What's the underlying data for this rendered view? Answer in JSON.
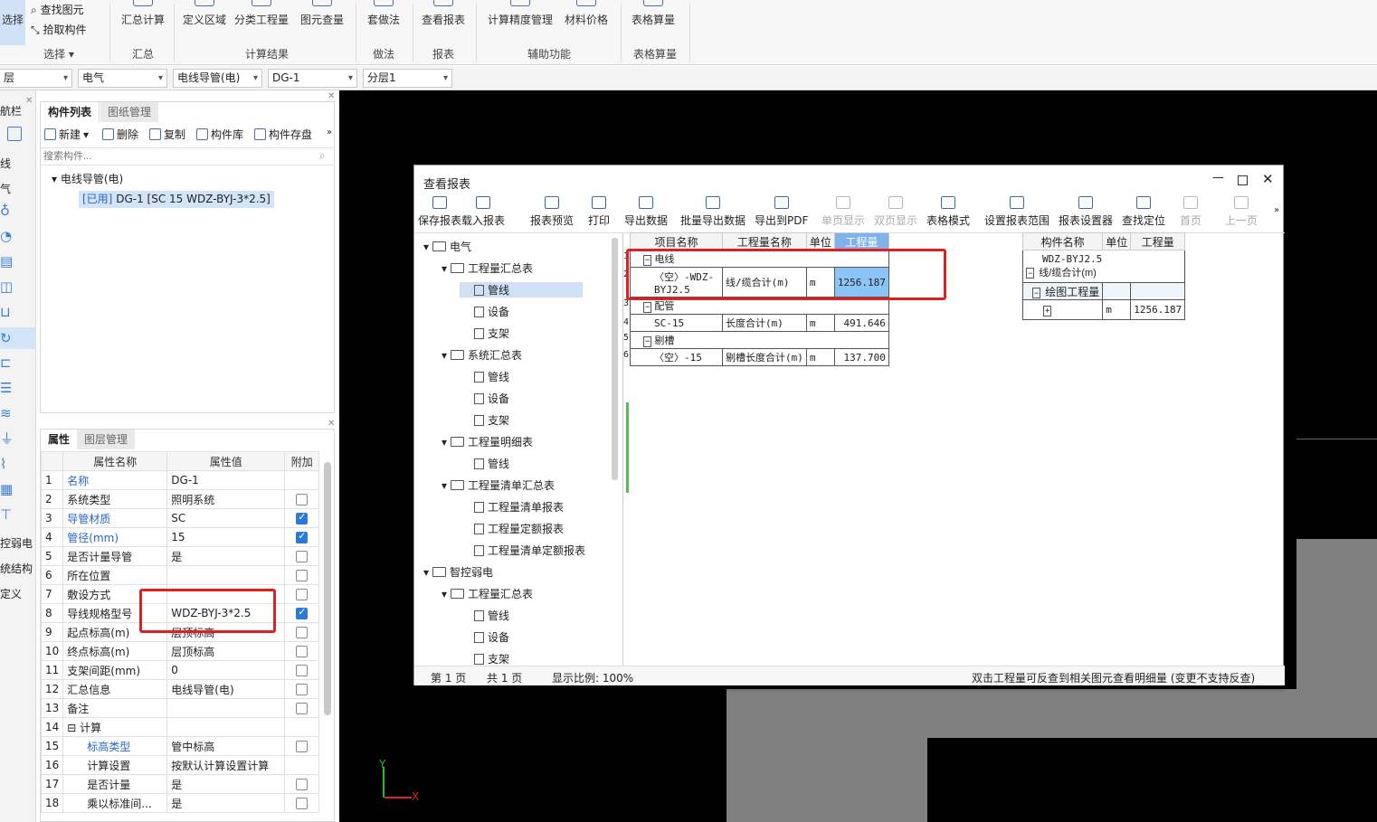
{
  "ribbon": {
    "select_btn": "选择",
    "find_elem": "查找图元",
    "pick_comp": "拾取构件",
    "select_group": "选择",
    "summary_btn": "汇总计算",
    "summary_group": "汇总",
    "calc_buttons": [
      "定义区域",
      "分类工程量",
      "图元查量"
    ],
    "calc_group": "计算结果",
    "method_btn": "套做法",
    "method_group": "做法",
    "report_btn": "查看报表",
    "report_group": "报表",
    "aux_buttons": [
      "计算精度管理",
      "材料价格"
    ],
    "aux_group": "辅助功能",
    "table_btn": "表格算量",
    "table_group": "表格算量"
  },
  "filter": {
    "layer": "层",
    "major": "电气",
    "type": "电线导管(电)",
    "name": "DG-1",
    "sublayer": "分层1"
  },
  "leftedge": {
    "nav": "航栏",
    "items": [
      "线",
      "气",
      "控弱电",
      "统结构",
      "定义"
    ]
  },
  "comp": {
    "tabs": [
      "构件列表",
      "图纸管理"
    ],
    "toolbar": [
      "新建",
      "删除",
      "复制",
      "构件库",
      "构件存盘"
    ],
    "search_placeholder": "搜索构件...",
    "group": "电线导管(电)",
    "item_tag": "[已用]",
    "item": "DG-1 [SC 15 WDZ-BYJ-3*2.5]"
  },
  "props": {
    "tabs": [
      "属性",
      "图层管理"
    ],
    "headers": [
      "属性名称",
      "属性值",
      "附加"
    ],
    "rows": [
      {
        "n": "1",
        "name": "名称",
        "val": "DG-1",
        "blue": true,
        "cb": null
      },
      {
        "n": "2",
        "name": "系统类型",
        "val": "照明系统",
        "blue": false,
        "cb": false
      },
      {
        "n": "3",
        "name": "导管材质",
        "val": "SC",
        "blue": true,
        "cb": true
      },
      {
        "n": "4",
        "name": "管径(mm)",
        "val": "15",
        "blue": true,
        "cb": true
      },
      {
        "n": "5",
        "name": "是否计量导管",
        "val": "是",
        "blue": false,
        "cb": false
      },
      {
        "n": "6",
        "name": "所在位置",
        "val": "",
        "blue": false,
        "cb": false
      },
      {
        "n": "7",
        "name": "敷设方式",
        "val": "",
        "blue": false,
        "cb": false
      },
      {
        "n": "8",
        "name": "导线规格型号",
        "val": "WDZ-BYJ-3*2.5",
        "blue": false,
        "cb": true
      },
      {
        "n": "9",
        "name": "起点标高(m)",
        "val": "层顶标高",
        "blue": false,
        "cb": false
      },
      {
        "n": "10",
        "name": "终点标高(m)",
        "val": "层顶标高",
        "blue": false,
        "cb": false
      },
      {
        "n": "11",
        "name": "支架间距(mm)",
        "val": "0",
        "blue": false,
        "cb": false
      },
      {
        "n": "12",
        "name": "汇总信息",
        "val": "电线导管(电)",
        "blue": false,
        "cb": false
      },
      {
        "n": "13",
        "name": "备注",
        "val": "",
        "blue": false,
        "cb": false
      },
      {
        "n": "14",
        "name": "计算",
        "val": "",
        "blue": false,
        "cb": null
      },
      {
        "n": "15",
        "name": "标高类型",
        "val": "管中标高",
        "blue": true,
        "cb": false
      },
      {
        "n": "16",
        "name": "计算设置",
        "val": "按默认计算设置计算",
        "blue": false,
        "cb": null
      },
      {
        "n": "17",
        "name": "是否计量",
        "val": "是",
        "blue": false,
        "cb": false
      },
      {
        "n": "18",
        "name": "乘以标准间...",
        "val": "是",
        "blue": false,
        "cb": false
      }
    ]
  },
  "dialog": {
    "title": "查看报表",
    "toolbar": [
      "保存报表",
      "载入报表",
      "报表预览",
      "打印",
      "导出数据",
      "批量导出数据",
      "导出到PDF",
      "单页显示",
      "双页显示",
      "表格模式",
      "设置报表范围",
      "报表设置器",
      "查找定位",
      "首页",
      "上一页"
    ],
    "tree": [
      {
        "lvl": 0,
        "t": "电气",
        "k": "f"
      },
      {
        "lvl": 1,
        "t": "工程量汇总表",
        "k": "f"
      },
      {
        "lvl": 2,
        "t": "管线",
        "k": "d",
        "sel": true
      },
      {
        "lvl": 2,
        "t": "设备",
        "k": "d"
      },
      {
        "lvl": 2,
        "t": "支架",
        "k": "d"
      },
      {
        "lvl": 1,
        "t": "系统汇总表",
        "k": "f"
      },
      {
        "lvl": 2,
        "t": "管线",
        "k": "d"
      },
      {
        "lvl": 2,
        "t": "设备",
        "k": "d"
      },
      {
        "lvl": 2,
        "t": "支架",
        "k": "d"
      },
      {
        "lvl": 1,
        "t": "工程量明细表",
        "k": "f"
      },
      {
        "lvl": 2,
        "t": "管线",
        "k": "d"
      },
      {
        "lvl": 1,
        "t": "工程量清单汇总表",
        "k": "f"
      },
      {
        "lvl": 2,
        "t": "工程量清单报表",
        "k": "d"
      },
      {
        "lvl": 2,
        "t": "工程量定额报表",
        "k": "d"
      },
      {
        "lvl": 2,
        "t": "工程量清单定额报表",
        "k": "d"
      },
      {
        "lvl": 0,
        "t": "智控弱电",
        "k": "f"
      },
      {
        "lvl": 1,
        "t": "工程量汇总表",
        "k": "f"
      },
      {
        "lvl": 2,
        "t": "管线",
        "k": "d"
      },
      {
        "lvl": 2,
        "t": "设备",
        "k": "d"
      },
      {
        "lvl": 2,
        "t": "支架",
        "k": "d"
      }
    ],
    "main_headers": [
      "项目名称",
      "工程量名称",
      "单位",
      "工程量"
    ],
    "main_rows": [
      {
        "n": "1",
        "group": "电线"
      },
      {
        "n": "2",
        "name": "〈空〉-WDZ-BYJ2.5",
        "qname": "线/缆合计(m)",
        "unit": "m",
        "val": "1256.187",
        "hl": true
      },
      {
        "n": "3",
        "group": "配管"
      },
      {
        "n": "4",
        "name": "SC-15",
        "qname": "长度合计(m)",
        "unit": "m",
        "val": "491.646"
      },
      {
        "n": "5",
        "group": "剔槽"
      },
      {
        "n": "6",
        "name": "〈空〉-15",
        "qname": "剔槽长度合计(m)",
        "unit": "m",
        "val": "137.700"
      }
    ],
    "side_headers": [
      "构件名称",
      "单位",
      "工程量"
    ],
    "side_title": "WDZ-BYJ2.5",
    "side_sub": "线/缆合计(m)",
    "side_group": "绘图工程量",
    "side_unit": "m",
    "side_val": "1256.187",
    "status": {
      "page": "第 1 页",
      "total": "共 1 页",
      "scale": "显示比例: 100%",
      "hint": "双击工程量可反查到相关图元查看明细量 (变更不支持反查)"
    }
  },
  "axis": {
    "y": "Y",
    "x": "X"
  }
}
